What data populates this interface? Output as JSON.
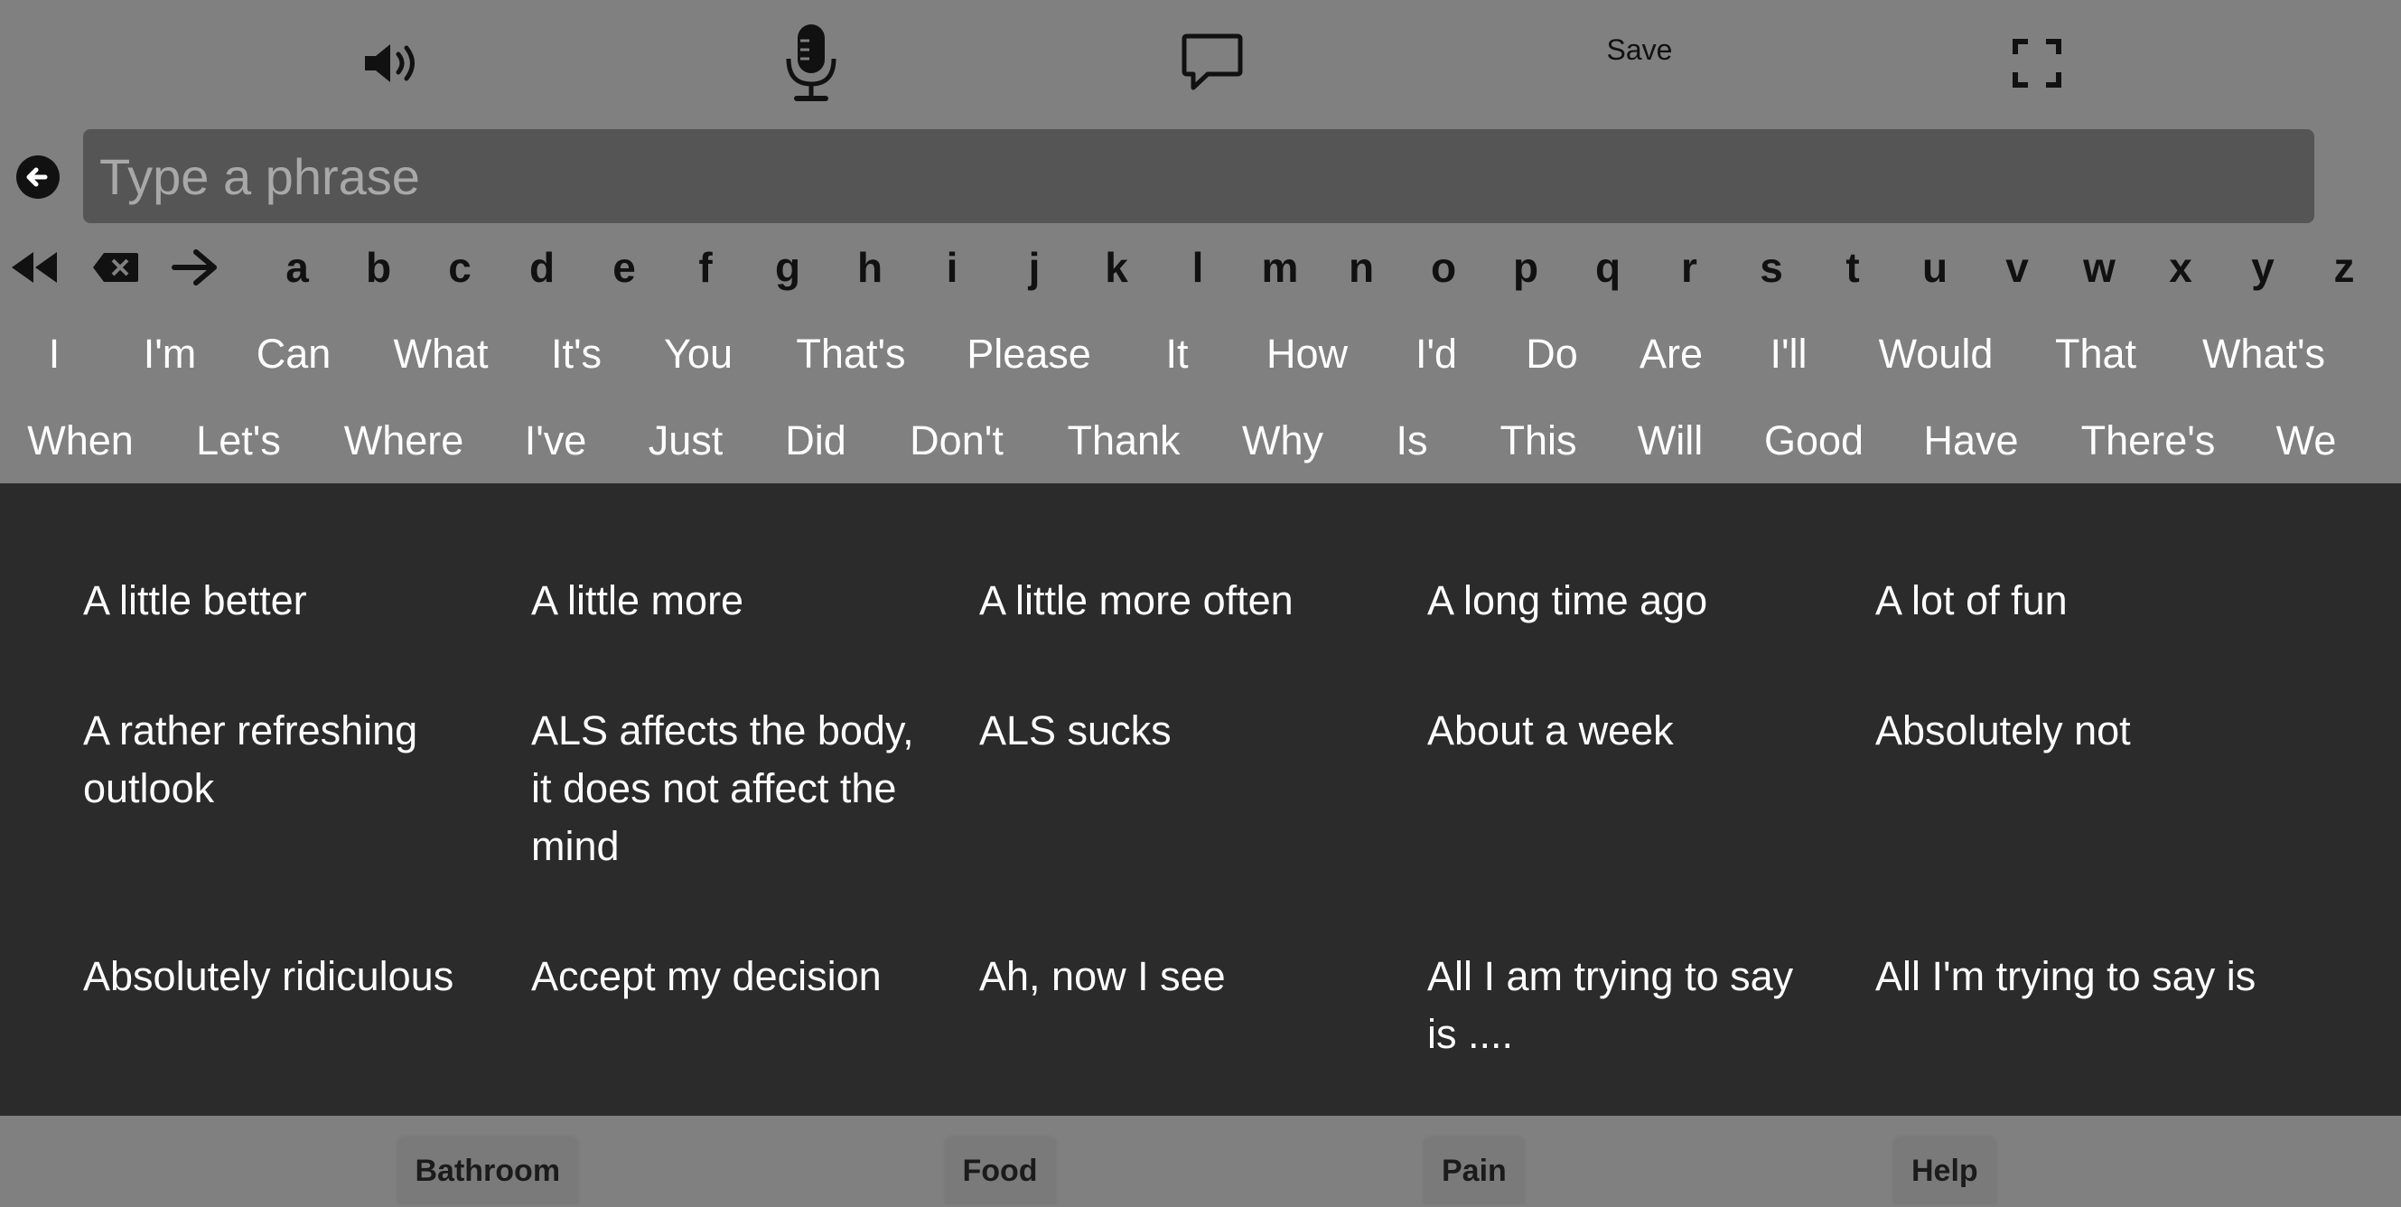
{
  "toolbar": {
    "speaker_icon": "speaker-icon",
    "mic_icon": "microphone-icon",
    "chat_icon": "chat-bubble-icon",
    "save_label": "Save",
    "fullscreen_icon": "fullscreen-icon"
  },
  "input": {
    "placeholder": "Type a phrase",
    "value": ""
  },
  "keyboard": {
    "controls": [
      "rewind-icon",
      "backspace-icon",
      "arrow-right-icon"
    ],
    "letters": [
      "a",
      "b",
      "c",
      "d",
      "e",
      "f",
      "g",
      "h",
      "i",
      "j",
      "k",
      "l",
      "m",
      "n",
      "o",
      "p",
      "q",
      "r",
      "s",
      "t",
      "u",
      "v",
      "w",
      "x",
      "y",
      "z"
    ]
  },
  "word_rows": [
    [
      "I",
      "I'm",
      "Can",
      "What",
      "It's",
      "You",
      "That's",
      "Please",
      "It",
      "How",
      "I'd",
      "Do",
      "Are",
      "I'll",
      "Would",
      "That",
      "What's"
    ],
    [
      "When",
      "Let's",
      "Where",
      "I've",
      "Just",
      "Did",
      "Don't",
      "Thank",
      "Why",
      "Is",
      "This",
      "Will",
      "Good",
      "Have",
      "There's",
      "We"
    ]
  ],
  "phrases": [
    [
      "A little better",
      "A little more",
      "A little more often",
      "A long time ago",
      "A lot of fun"
    ],
    [
      "A rather refreshing outlook",
      "ALS affects the body, it does not affect the mind",
      "ALS sucks",
      "About a week",
      "Absolutely not"
    ],
    [
      "Absolutely ridiculous",
      "Accept my decision",
      "Ah, now I see",
      "All I am trying to say is ....",
      "All I'm trying to say is"
    ]
  ],
  "quick_buttons": [
    "Bathroom",
    "Food",
    "Pain",
    "Help"
  ],
  "colors": {
    "header_bg": "#808080",
    "input_bg": "#555555",
    "phrase_area_bg": "#2b2b2b",
    "phrase_text": "#ffffff"
  }
}
